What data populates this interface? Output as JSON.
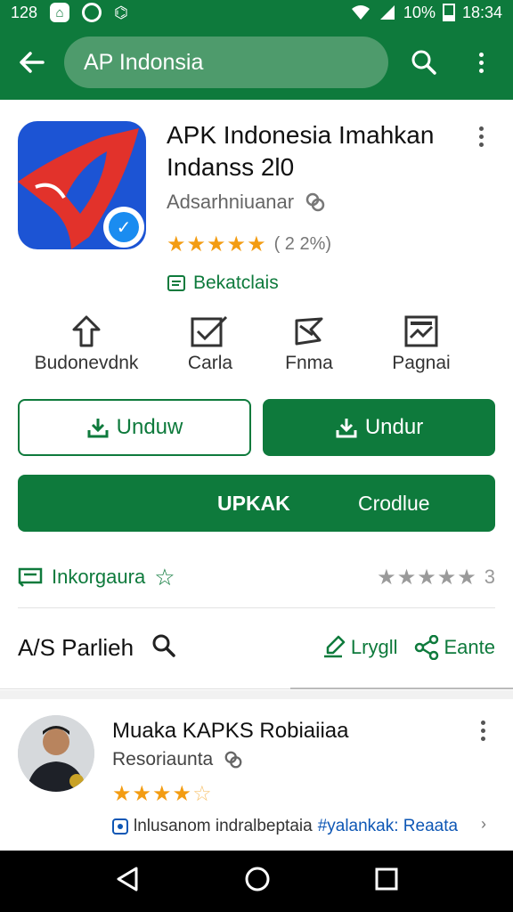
{
  "status_bar": {
    "time_left": "128",
    "battery_percent": "10%",
    "time_right": "18:34"
  },
  "app_bar": {
    "search_text": "AP Indonsia"
  },
  "app": {
    "title_line1": "APK Indonesia Imahkan",
    "title_line2": "Indanss 2l0",
    "developer": "Adsarhniuanar",
    "rating_stars": "★★★★★",
    "rating_count": "( 2 2%)",
    "tag": "Bekatclais"
  },
  "features": [
    {
      "label": "Budonevdnk",
      "icon": "up-arrow-icon"
    },
    {
      "label": "Carla",
      "icon": "checklist-icon"
    },
    {
      "label": "Fnma",
      "icon": "shape-icon"
    },
    {
      "label": "Pagnai",
      "icon": "image-frame-icon"
    }
  ],
  "buttons": {
    "outline_label": "Unduw",
    "solid_label": "Undur",
    "wide_left": "UPKAK",
    "wide_right": "Crodlue"
  },
  "info_row": {
    "left_label": "Inkorgaura",
    "right_stars": "★★★★★",
    "right_count": "3"
  },
  "apps_section": {
    "title": "A/S Parlieh",
    "action1": "Lrygll",
    "action2": "Eante"
  },
  "review": {
    "name": "Muaka KAPKS Robiaiiaa",
    "subtitle": "Resoriaunta",
    "stars_filled": "★★★★",
    "stars_empty": "☆",
    "text_plain": "lnlusanom indralbeptaia",
    "text_tagged": "#yalankak: Reaata"
  },
  "colors": {
    "primary_green": "#0e7a3c",
    "star_orange": "#f39c12",
    "app_icon_blue": "#1c54d4",
    "app_icon_red": "#e2322b"
  }
}
